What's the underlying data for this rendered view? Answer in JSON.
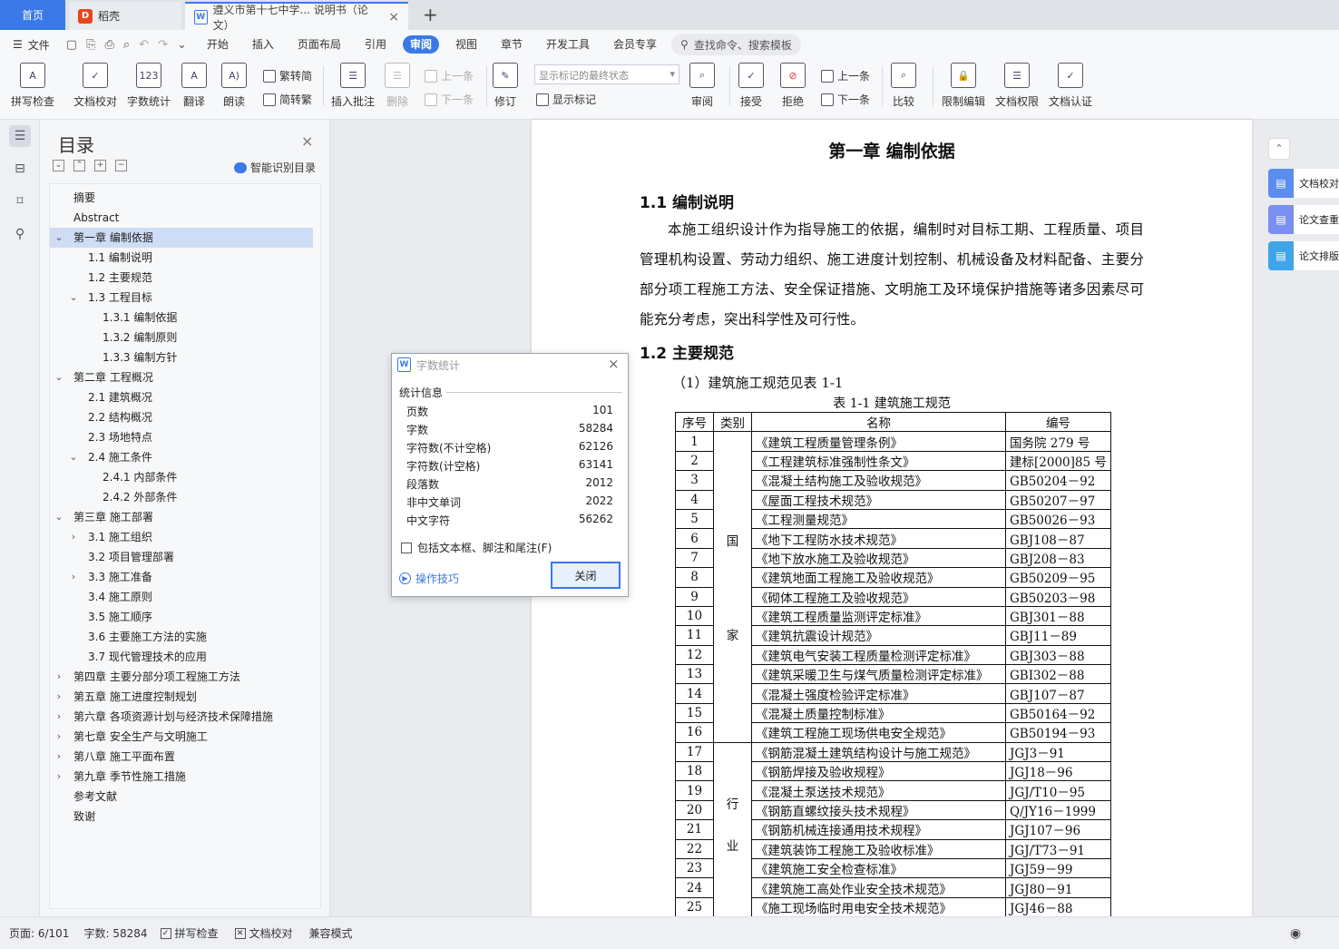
{
  "tabs": {
    "home": "首页",
    "daoke": "稻壳",
    "doc": "遵义市第十七中学... 说明书（论文）"
  },
  "menubar": {
    "file": "文件",
    "items": [
      "开始",
      "插入",
      "页面布局",
      "引用",
      "审阅",
      "视图",
      "章节",
      "开发工具",
      "会员专享"
    ],
    "active": "审阅",
    "search": "查找命令、搜索模板"
  },
  "ribbon": {
    "spell": "拼写检查",
    "proof": "文档校对",
    "wordcount": "字数统计",
    "translate": "翻译",
    "read": "朗读",
    "trad_to_simp": "繁转简",
    "simp_to_trad": "简转繁",
    "insert_comment": "插入批注",
    "delete": "删除",
    "prev_comment": "上一条",
    "next_comment": "下一条",
    "track": "修订",
    "display_mode": "显示标记的最终状态",
    "show_markup": "显示标记",
    "review": "审阅",
    "accept": "接受",
    "reject": "拒绝",
    "prev_change": "上一条",
    "next_change": "下一条",
    "compare": "比较",
    "restrict": "限制编辑",
    "doc_rights": "文档权限",
    "doc_cert": "文档认证"
  },
  "toc": {
    "title": "目录",
    "smart": "智能识别目录",
    "items": [
      {
        "label": "摘要",
        "level": 0,
        "chev": ""
      },
      {
        "label": "Abstract",
        "level": 0,
        "chev": ""
      },
      {
        "label": "第一章  编制依据",
        "level": 0,
        "chev": "v"
      },
      {
        "label": "1.1  编制说明",
        "level": 1,
        "chev": ""
      },
      {
        "label": "1.2  主要规范",
        "level": 1,
        "chev": ""
      },
      {
        "label": "1.3  工程目标",
        "level": 1,
        "chev": "v"
      },
      {
        "label": "1.3.1  编制依据",
        "level": 2,
        "chev": ""
      },
      {
        "label": "1.3.2  编制原则",
        "level": 2,
        "chev": ""
      },
      {
        "label": "1.3.3  编制方针",
        "level": 2,
        "chev": ""
      },
      {
        "label": "第二章  工程概况",
        "level": 0,
        "chev": "v"
      },
      {
        "label": "2.1  建筑概况",
        "level": 1,
        "chev": ""
      },
      {
        "label": "2.2  结构概况",
        "level": 1,
        "chev": ""
      },
      {
        "label": "2.3  场地特点",
        "level": 1,
        "chev": ""
      },
      {
        "label": "2.4  施工条件",
        "level": 1,
        "chev": "v"
      },
      {
        "label": "2.4.1  内部条件",
        "level": 2,
        "chev": ""
      },
      {
        "label": "2.4.2  外部条件",
        "level": 2,
        "chev": ""
      },
      {
        "label": "第三章  施工部署",
        "level": 0,
        "chev": "v"
      },
      {
        "label": "3.1  施工组织",
        "level": 1,
        "chev": ">"
      },
      {
        "label": "3.2  项目管理部署",
        "level": 1,
        "chev": ""
      },
      {
        "label": "3.3  施工准备",
        "level": 1,
        "chev": ">"
      },
      {
        "label": "3.4  施工原则",
        "level": 1,
        "chev": ""
      },
      {
        "label": "3.5  施工顺序",
        "level": 1,
        "chev": ""
      },
      {
        "label": "3.6  主要施工方法的实施",
        "level": 1,
        "chev": ""
      },
      {
        "label": "3.7  现代管理技术的应用",
        "level": 1,
        "chev": ""
      },
      {
        "label": "第四章  主要分部分项工程施工方法",
        "level": 0,
        "chev": ">"
      },
      {
        "label": "第五章  施工进度控制规划",
        "level": 0,
        "chev": ">"
      },
      {
        "label": "第六章  各项资源计划与经济技术保障措施",
        "level": 0,
        "chev": ">"
      },
      {
        "label": "第七章  安全生产与文明施工",
        "level": 0,
        "chev": ">"
      },
      {
        "label": "第八章  施工平面布置",
        "level": 0,
        "chev": ">"
      },
      {
        "label": "第九章  季节性施工措施",
        "level": 0,
        "chev": ">"
      },
      {
        "label": "参考文献",
        "level": 0,
        "chev": ""
      },
      {
        "label": "致谢",
        "level": 0,
        "chev": ""
      }
    ],
    "selected": 2
  },
  "document": {
    "chapter_title": "第一章  编制依据",
    "h_1_1": "1.1  编制说明",
    "para": "本施工组织设计作为指导施工的依据，编制时对目标工期、工程质量、项目管理机构设置、劳动力组织、施工进度计划控制、机械设备及材料配备、主要分部分项工程施工方法、安全保证措施、文明施工及环境保护措施等诸多因素尽可能充分考虑，突出科学性及可行性。",
    "h_1_2": "1.2  主要规范",
    "sub": "（1）建筑施工规范见表 1-1",
    "table_caption": "表 1-1  建筑施工规范",
    "table_headers": [
      "序号",
      "类别",
      "名称",
      "编号"
    ],
    "cat_national": [
      "国",
      "家"
    ],
    "cat_industry": [
      "行",
      "业"
    ],
    "rows": [
      [
        "1",
        "《建筑工程质量管理条例》",
        "国务院 279 号"
      ],
      [
        "2",
        "《工程建筑标准强制性条文》",
        "建标[2000]85 号"
      ],
      [
        "3",
        "《混凝土结构施工及验收规范》",
        "GB50204－92"
      ],
      [
        "4",
        "《屋面工程技术规范》",
        "GB50207－97"
      ],
      [
        "5",
        "《工程测量规范》",
        "GB50026－93"
      ],
      [
        "6",
        "《地下工程防水技术规范》",
        "GBJ108－87"
      ],
      [
        "7",
        "《地下放水施工及验收规范》",
        "GBJ208－83"
      ],
      [
        "8",
        "《建筑地面工程施工及验收规范》",
        "GB50209－95"
      ],
      [
        "9",
        "《砌体工程施工及验收规范》",
        "GB50203－98"
      ],
      [
        "10",
        "《建筑工程质量监测评定标准》",
        "GBJ301－88"
      ],
      [
        "11",
        "《建筑抗震设计规范》",
        "GBJ11－89"
      ],
      [
        "12",
        "《建筑电气安装工程质量检测评定标准》",
        "GBJ303－88"
      ],
      [
        "13",
        "《建筑采暖卫生与煤气质量检测评定标准》",
        "GBI302－88"
      ],
      [
        "14",
        "《混凝土强度检验评定标准》",
        "GBJ107－87"
      ],
      [
        "15",
        "《混凝土质量控制标准》",
        "GB50164－92"
      ],
      [
        "16",
        "《建筑工程施工现场供电安全规范》",
        "GB50194－93"
      ],
      [
        "17",
        "《钢筋混凝土建筑结构设计与施工规范》",
        "JGJ3－91"
      ],
      [
        "18",
        "《钢筋焊接及验收规程》",
        "JGJ18－96"
      ],
      [
        "19",
        "《混凝土泵送技术规范》",
        "JGJ/T10－95"
      ],
      [
        "20",
        "《钢筋直螺纹接头技术规程》",
        "Q/JY16－1999"
      ],
      [
        "21",
        "《钢筋机械连接通用技术规程》",
        "JGJ107－96"
      ],
      [
        "22",
        "《建筑装饰工程施工及验收标准》",
        "JGJ/T73－91"
      ],
      [
        "23",
        "《建筑施工安全检查标准》",
        "JGJ59－99"
      ],
      [
        "24",
        "《建筑施工高处作业安全技术规范》",
        "JGJ80－91"
      ],
      [
        "25",
        "《施工现场临时用电安全技术规范》",
        "JGJ46－88"
      ]
    ]
  },
  "rightpanel": {
    "items": [
      "文档校对",
      "论文查重",
      "论文排版"
    ],
    "colors": [
      "#5b8def",
      "#7b8ff0",
      "#3fa5e8"
    ]
  },
  "dialog": {
    "title": "字数统计",
    "section": "统计信息",
    "stats": [
      [
        "页数",
        "101"
      ],
      [
        "字数",
        "58284"
      ],
      [
        "字符数(不计空格)",
        "62126"
      ],
      [
        "字符数(计空格)",
        "63141"
      ],
      [
        "段落数",
        "2012"
      ],
      [
        "非中文单词",
        "2022"
      ],
      [
        "中文字符",
        "56262"
      ]
    ],
    "checkbox": "包括文本框、脚注和尾注(F)",
    "tips": "操作技巧",
    "close": "关闭"
  },
  "status": {
    "page": "页面: 6/101",
    "words": "字数: 58284",
    "spell": "拼写检查",
    "proof": "文档校对",
    "compat": "兼容模式"
  }
}
